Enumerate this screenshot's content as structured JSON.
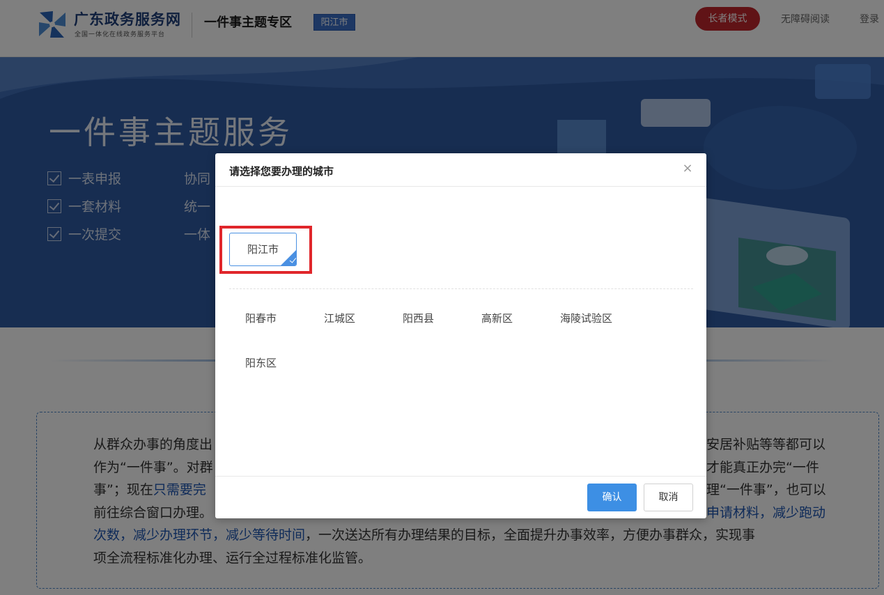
{
  "header": {
    "logo_title": "广东政务服务网",
    "logo_subtitle": "全国一体化在线政务服务平台",
    "zone_title": "一件事主题专区",
    "city_tag": "阳江市",
    "elder_mode": "长者模式",
    "accessible_reading": "无障碍阅读",
    "login": "登录"
  },
  "banner": {
    "title": "一件事主题服务",
    "features": [
      "一表申报",
      "一套材料",
      "一次提交"
    ],
    "features_right": [
      "协同",
      "统一",
      "一体"
    ]
  },
  "description": {
    "line1": "从群众办事的角度出",
    "line1_end": "安居补贴等等都可以",
    "line2": "作为“一件事”。对群",
    "line2_end": "才能真正办完“一件",
    "line3a": "事”；现在",
    "line3_hl": "只需要完",
    "line3_end": "理“一件事”，也可以",
    "line4": "前往综合窗口办理。",
    "line4_hl": "申请材料，减少跑动",
    "line5_hl": "次数，减少办理环节，减少等待时间",
    "line5_end": "，一次送达所有办理结果的目标，全面提升办事效率，方便办事群众，实现事",
    "line6": "项全流程标准化办理、运行全过程标准化监管。"
  },
  "modal": {
    "title": "请选择您要办理的城市",
    "close_icon": "×",
    "selected_city": "阳江市",
    "districts": [
      "阳春市",
      "江城区",
      "阳西县",
      "高新区",
      "海陵试验区",
      "阳东区"
    ],
    "confirm": "确认",
    "cancel": "取消"
  },
  "colors": {
    "accent": "#3d8fe4",
    "elder_button": "#c0262d",
    "highlight": "#e0262b",
    "banner": "#2f5aa3"
  }
}
